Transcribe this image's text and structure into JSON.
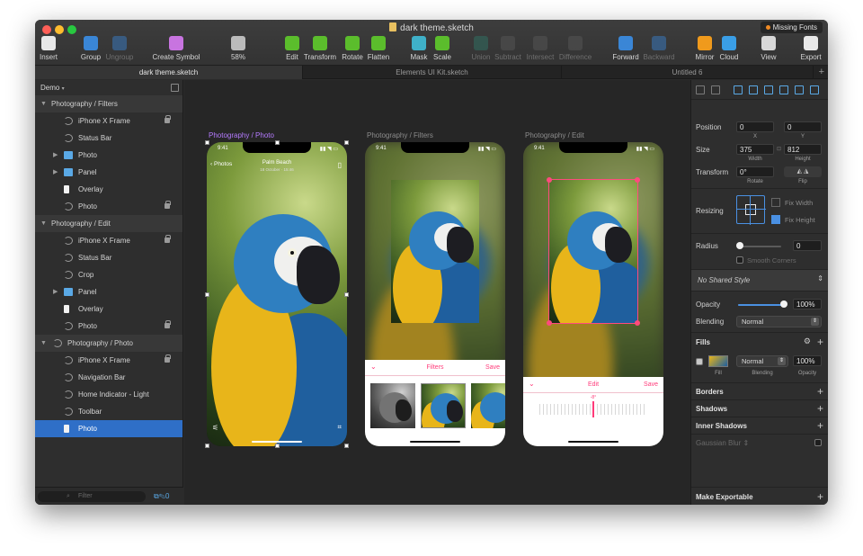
{
  "window": {
    "title": "dark theme.sketch",
    "missing_fonts": "Missing Fonts"
  },
  "toolbar": [
    {
      "label": "Insert",
      "icon": "plus-icon",
      "color": "#e8e8e8",
      "dim": false
    },
    {
      "label": "Group",
      "icon": "group-icon",
      "color": "#3a86d6",
      "dim": false
    },
    {
      "label": "Ungroup",
      "icon": "ungroup-icon",
      "color": "#3a86d6",
      "dim": true
    },
    {
      "label": "Create Symbol",
      "icon": "symbol-icon",
      "color": "#c874e0",
      "dim": false
    },
    {
      "label": "58%",
      "icon": "zoom-icon",
      "color": "#bbbbbb",
      "dim": false
    },
    {
      "label": "Edit",
      "icon": "edit-icon",
      "color": "#5bbd2c",
      "dim": false
    },
    {
      "label": "Transform",
      "icon": "transform-icon",
      "color": "#5bbd2c",
      "dim": false
    },
    {
      "label": "Rotate",
      "icon": "rotate-icon",
      "color": "#5bbd2c",
      "dim": false
    },
    {
      "label": "Flatten",
      "icon": "flatten-icon",
      "color": "#5bbd2c",
      "dim": false
    },
    {
      "label": "Mask",
      "icon": "mask-icon",
      "color": "#3fb0c8",
      "dim": false
    },
    {
      "label": "Scale",
      "icon": "scale-icon",
      "color": "#5bbd2c",
      "dim": false
    },
    {
      "label": "Union",
      "icon": "union-icon",
      "color": "#2f7a6a",
      "dim": true
    },
    {
      "label": "Subtract",
      "icon": "subtract-icon",
      "color": "#5a5a5a",
      "dim": true
    },
    {
      "label": "Intersect",
      "icon": "intersect-icon",
      "color": "#5a5a5a",
      "dim": true
    },
    {
      "label": "Difference",
      "icon": "difference-icon",
      "color": "#5a5a5a",
      "dim": true
    },
    {
      "label": "Forward",
      "icon": "forward-icon",
      "color": "#3a86d6",
      "dim": false
    },
    {
      "label": "Backward",
      "icon": "backward-icon",
      "color": "#3a86d6",
      "dim": true
    },
    {
      "label": "Mirror",
      "icon": "mirror-icon",
      "color": "#f09a1c",
      "dim": false
    },
    {
      "label": "Cloud",
      "icon": "cloud-icon",
      "color": "#3a9ee6",
      "dim": false
    },
    {
      "label": "View",
      "icon": "view-icon",
      "color": "#d8d8d8",
      "dim": false
    },
    {
      "label": "Export",
      "icon": "export-icon",
      "color": "#e8e8e8",
      "dim": false
    }
  ],
  "tabs": [
    "dark theme.sketch",
    "Elements UI Kit.sketch",
    "Untitled 6"
  ],
  "sidebar": {
    "page": "Demo",
    "filter_placeholder": "Filter",
    "layers": [
      {
        "label": "Photography / Filters",
        "type": "group"
      },
      {
        "label": "iPhone X Frame",
        "type": "symbol",
        "lock": true
      },
      {
        "label": "Status Bar",
        "type": "symbol"
      },
      {
        "label": "Photo",
        "type": "folder"
      },
      {
        "label": "Panel",
        "type": "folder"
      },
      {
        "label": "Overlay",
        "type": "rect"
      },
      {
        "label": "Photo",
        "type": "symbol",
        "lock": true
      },
      {
        "label": "Photography / Edit",
        "type": "group"
      },
      {
        "label": "iPhone X Frame",
        "type": "symbol",
        "lock": true
      },
      {
        "label": "Status Bar",
        "type": "symbol"
      },
      {
        "label": "Crop",
        "type": "symbol"
      },
      {
        "label": "Panel",
        "type": "folder"
      },
      {
        "label": "Overlay",
        "type": "rect"
      },
      {
        "label": "Photo",
        "type": "symbol",
        "lock": true
      },
      {
        "label": "Photography / Photo",
        "type": "group-symbol"
      },
      {
        "label": "iPhone X Frame",
        "type": "symbol",
        "lock": true
      },
      {
        "label": "Navigation Bar",
        "type": "symbol"
      },
      {
        "label": "Home Indicator - Light",
        "type": "symbol"
      },
      {
        "label": "Toolbar",
        "type": "symbol"
      },
      {
        "label": "Photo",
        "type": "rect",
        "selected": true
      }
    ]
  },
  "canvas": {
    "artboards": [
      "Photography / Photo",
      "Photography / Filters",
      "Photography / Edit"
    ],
    "time": "9:41",
    "nav_back": "Photos",
    "nav_title": "Palm Beach",
    "nav_subtitle": "18 October · 15:46",
    "filters_label": "Filters",
    "save_label": "Save",
    "edit_label": "Edit",
    "angle": "-8°"
  },
  "inspector": {
    "position_label": "Position",
    "x": "0",
    "y": "0",
    "x_label": "X",
    "y_label": "Y",
    "size_label": "Size",
    "width": "375",
    "height": "812",
    "width_label": "Width",
    "height_label": "Height",
    "transform_label": "Transform",
    "rotate": "0°",
    "rotate_label": "Rotate",
    "flip_label": "Flip",
    "resizing_label": "Resizing",
    "fix_width": "Fix Width",
    "fix_height": "Fix Height",
    "radius_label": "Radius",
    "radius": "0",
    "smooth_corners": "Smooth Corners",
    "shared_style": "No Shared Style",
    "opacity_label": "Opacity",
    "opacity": "100%",
    "blending_label": "Blending",
    "blending": "Normal",
    "fills_label": "Fills",
    "fill_label": "Fill",
    "fill_blending": "Normal",
    "fill_blending_label": "Blending",
    "fill_opacity": "100%",
    "fill_opacity_label": "Opacity",
    "borders_label": "Borders",
    "shadows_label": "Shadows",
    "inner_shadows_label": "Inner Shadows",
    "gaussian_blur": "Gaussian Blur",
    "make_exportable": "Make Exportable"
  },
  "colors": {
    "accent": "#2f6fc7",
    "selection": "#b57bff",
    "handles": "#ff4a7d",
    "ios_pink": "#ff3b7a"
  }
}
